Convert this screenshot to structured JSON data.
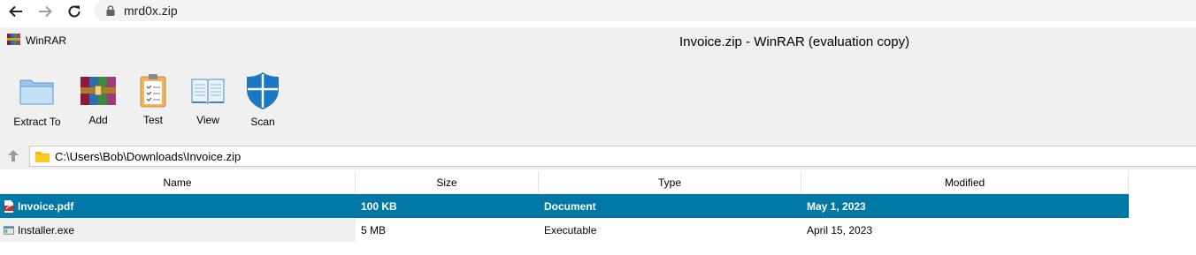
{
  "browser": {
    "url": "mrd0x.zip"
  },
  "window": {
    "app_name": "WinRAR",
    "title": "Invoice.zip - WinRAR (evaluation copy)"
  },
  "toolbar": {
    "items": [
      {
        "label": "Extract To",
        "icon": "folder-icon"
      },
      {
        "label": "Add",
        "icon": "archive-books-icon"
      },
      {
        "label": "Test",
        "icon": "clipboard-check-icon"
      },
      {
        "label": "View",
        "icon": "open-book-icon"
      },
      {
        "label": "Scan",
        "icon": "shield-icon"
      }
    ]
  },
  "path": {
    "value": "C:\\Users\\Bob\\Downloads\\Invoice.zip"
  },
  "filelist": {
    "columns": [
      "Name",
      "Size",
      "Type",
      "Modified"
    ],
    "rows": [
      {
        "name": "Invoice.pdf",
        "size": "100 KB",
        "type": "Document",
        "modified": "May 1, 2023",
        "icon": "pdf-icon",
        "selected": true
      },
      {
        "name": "Installer.exe",
        "size": "5 MB",
        "type": "Executable",
        "modified": "April 15, 2023",
        "icon": "exe-icon",
        "selected": false
      }
    ]
  },
  "colors": {
    "selection": "#0078a6",
    "window_bg": "#f0f0f0",
    "scan_shield": "#1a78c2"
  }
}
